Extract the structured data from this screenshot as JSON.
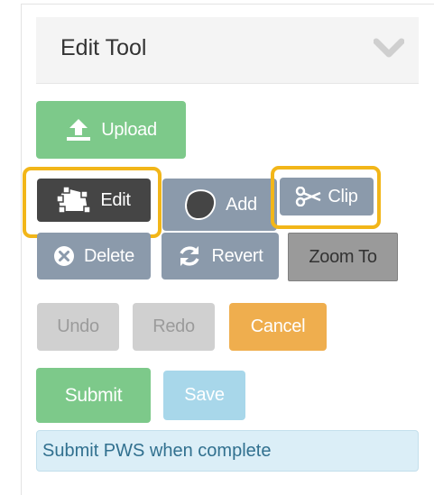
{
  "header": {
    "title": "Edit Tool",
    "toggle_icon": "chevron-down-icon"
  },
  "buttons": {
    "upload": {
      "label": "Upload",
      "icon": "upload-icon"
    },
    "edit": {
      "label": "Edit",
      "icon": "polygon-edit-icon"
    },
    "add": {
      "label": "Add",
      "icon": "blob-shape-icon"
    },
    "clip": {
      "label": "Clip",
      "icon": "scissors-icon"
    },
    "delete": {
      "label": "Delete",
      "icon": "close-circle-icon"
    },
    "revert": {
      "label": "Revert",
      "icon": "refresh-icon"
    },
    "zoom_to": {
      "label": "Zoom To"
    },
    "undo": {
      "label": "Undo"
    },
    "redo": {
      "label": "Redo"
    },
    "cancel": {
      "label": "Cancel"
    },
    "submit": {
      "label": "Submit"
    },
    "save": {
      "label": "Save"
    }
  },
  "info": {
    "message": "Submit PWS when complete"
  },
  "colors": {
    "highlight": "#f2b619",
    "green": "#7dc98a",
    "slate": "#8b9aab",
    "dark": "#454545",
    "orange": "#efae4e",
    "sky": "#a8d7ea",
    "info_bg": "#dbeef7",
    "info_text": "#31708f"
  }
}
